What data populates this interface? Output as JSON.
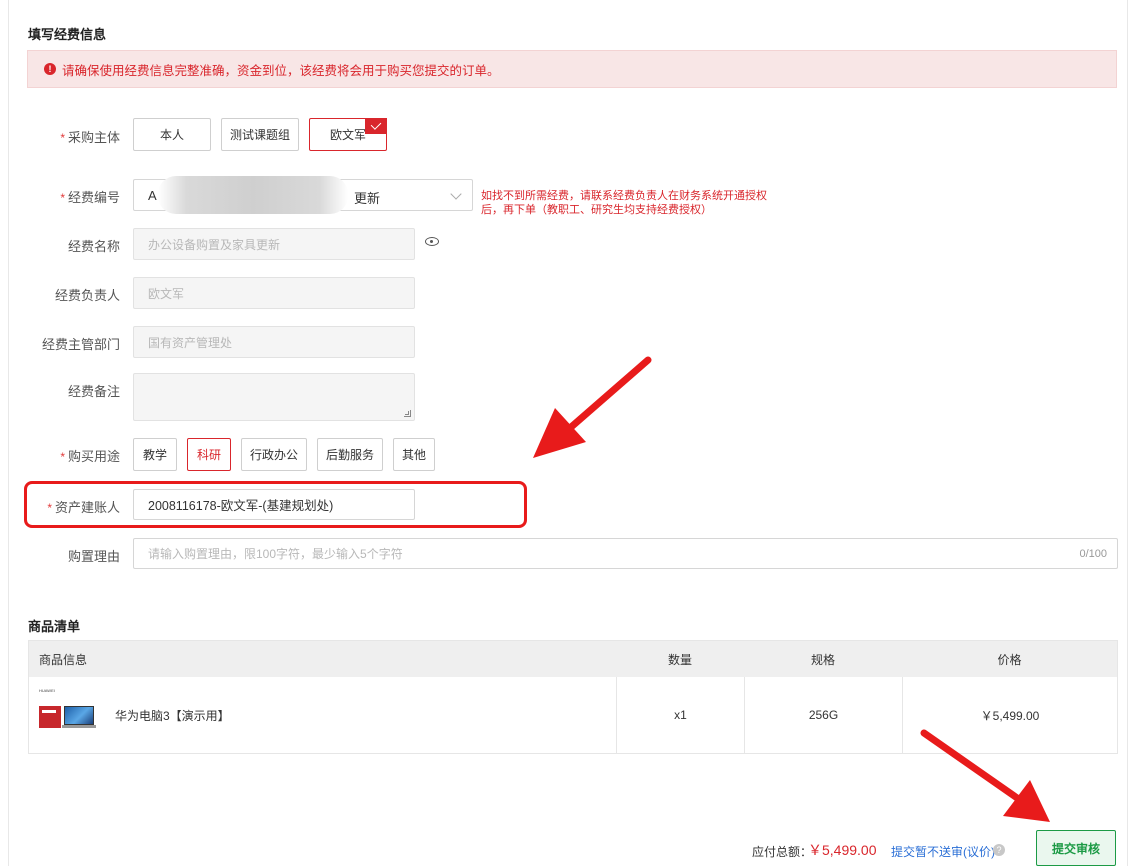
{
  "sections": {
    "fund_info_title": "填写经费信息",
    "goods_list_title": "商品清单"
  },
  "alert": {
    "icon": "exclamation-circle-icon",
    "icon_glyph": "!",
    "text": "请确保使用经费信息完整准确，资金到位，该经费将会用于购买您提交的订单。"
  },
  "form": {
    "required_mark": "*",
    "purchaser": {
      "label": "采购主体",
      "options": [
        "本人",
        "测试课题组",
        "欧文军"
      ],
      "selected": "欧文军"
    },
    "fund_code": {
      "label": "经费编号",
      "value_prefix": "A",
      "value_suffix": "更新",
      "hint": "如找不到所需经费，请联系经费负责人在财务系统开通授权后，再下单（教职工、研究生均支持经费授权）"
    },
    "fund_name": {
      "label": "经费名称",
      "placeholder": "办公设备购置及家具更新"
    },
    "fund_owner": {
      "label": "经费负责人",
      "placeholder": "欧文军"
    },
    "fund_dept": {
      "label": "经费主管部门",
      "placeholder": "国有资产管理处"
    },
    "fund_note": {
      "label": "经费备注"
    },
    "usage": {
      "label": "购买用途",
      "options": [
        "教学",
        "科研",
        "行政办公",
        "后勤服务",
        "其他"
      ],
      "selected": "科研"
    },
    "asset_owner": {
      "label": "资产建账人",
      "value": "2008116178-欧文军-(基建规划处)"
    },
    "reason": {
      "label": "购置理由",
      "placeholder": "请输入购置理由，限100字符，最少输入5个字符",
      "counter": "0/100"
    }
  },
  "table": {
    "headers": [
      "商品信息",
      "数量",
      "规格",
      "价格"
    ],
    "rows": [
      {
        "brand": "HUAWEI",
        "name": "华为电脑3【演示用】",
        "qty": "x1",
        "spec": "256G",
        "price": "￥5,499.00"
      }
    ]
  },
  "footer": {
    "total_label": "应付总额：",
    "total_value": "￥5,499.00",
    "save_link": "提交暂不送审(议价)",
    "help_glyph": "?",
    "submit_label": "提交审核"
  },
  "colors": {
    "accent_red": "#d9262c",
    "annotation_red": "#e81b1b",
    "submit_green": "#1c9a45",
    "link_blue": "#2b6fd6"
  }
}
